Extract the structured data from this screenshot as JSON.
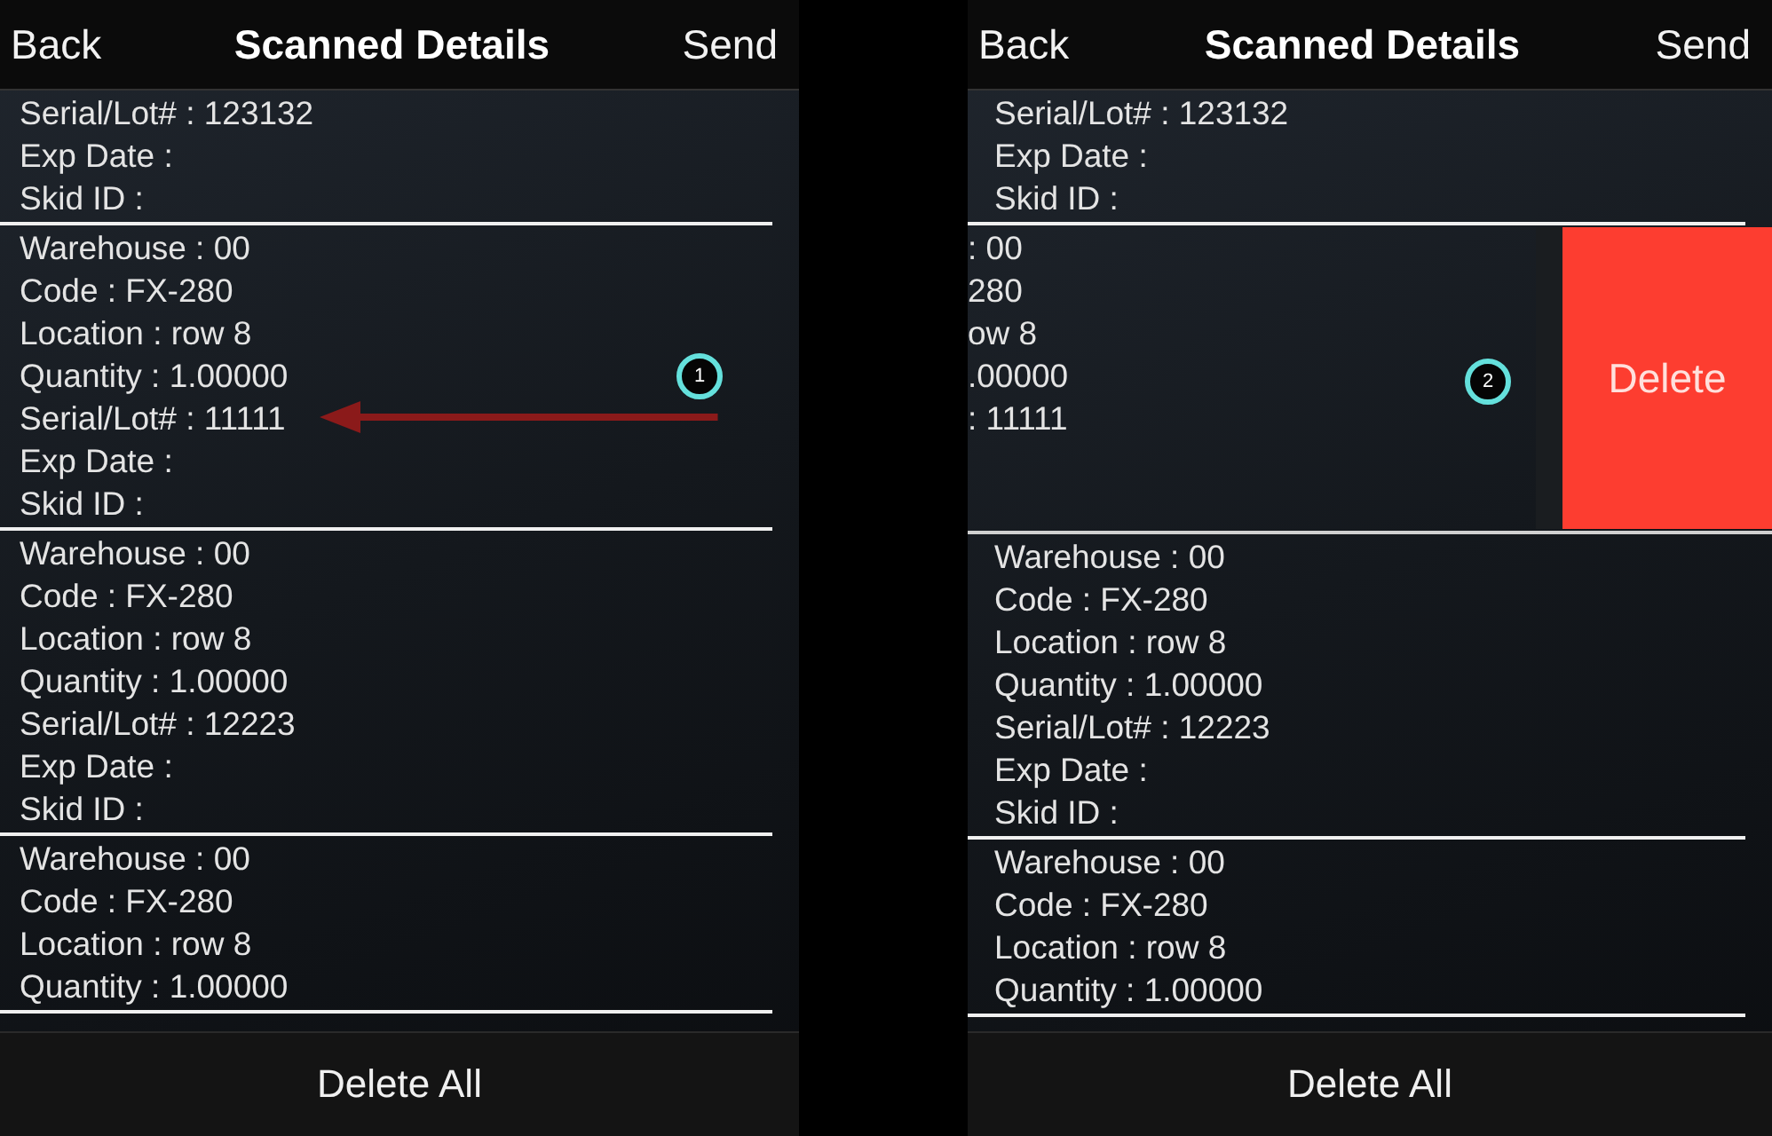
{
  "screens": [
    {
      "nav": {
        "back": "Back",
        "title": "Scanned Details",
        "send": "Send"
      },
      "records": [
        {
          "swiped": false,
          "lines": [
            "Serial/Lot# : 123132",
            "Exp Date :",
            "Skid ID :"
          ]
        },
        {
          "swiped": false,
          "callout": "1",
          "arrow": true,
          "lines": [
            "Warehouse : 00",
            "Code : FX-280",
            "Location : row 8",
            "Quantity : 1.00000",
            "Serial/Lot# : 11111",
            "Exp Date :",
            "Skid ID :"
          ]
        },
        {
          "swiped": false,
          "lines": [
            "Warehouse : 00",
            "Code : FX-280",
            "Location : row 8",
            "Quantity : 1.00000",
            "Serial/Lot# : 12223",
            "Exp Date :",
            "Skid ID :"
          ]
        },
        {
          "swiped": false,
          "lines": [
            "Warehouse : 00",
            "Code : FX-280",
            "Location : row 8",
            "Quantity : 1.00000"
          ]
        }
      ],
      "footer": "Delete All"
    },
    {
      "nav": {
        "back": "Back",
        "title": "Scanned Details",
        "send": "Send"
      },
      "records": [
        {
          "swiped": false,
          "lines": [
            "Serial/Lot# : 123132",
            "Exp Date :",
            "Skid ID :"
          ]
        },
        {
          "swiped": true,
          "action": "Delete",
          "callout": "2",
          "lines": [
            ": 00",
            "280",
            "ow 8",
            ".00000",
            ": 11111"
          ]
        },
        {
          "swiped": false,
          "lines": [
            "Warehouse : 00",
            "Code : FX-280",
            "Location : row 8",
            "Quantity : 1.00000",
            "Serial/Lot# : 12223",
            "Exp Date :",
            "Skid ID :"
          ]
        },
        {
          "swiped": false,
          "lines": [
            "Warehouse : 00",
            "Code : FX-280",
            "Location : row 8",
            "Quantity : 1.00000"
          ]
        }
      ],
      "footer": "Delete All"
    }
  ]
}
